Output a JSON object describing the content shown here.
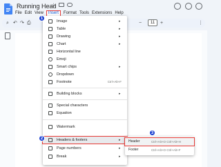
{
  "window": {
    "title": "Running Head"
  },
  "menubar": {
    "items": [
      "File",
      "Edit",
      "View",
      "Insert",
      "Format",
      "Tools",
      "Extensions",
      "Help"
    ]
  },
  "toolbar": {
    "font_size": "11",
    "icons": [
      "search-icon",
      "undo-icon",
      "redo-icon",
      "print-icon",
      "zoom-out-icon",
      "zoom-in-icon",
      "more-icon"
    ]
  },
  "insert_menu": {
    "items": [
      {
        "label": "Image",
        "submenu": true,
        "icon": "image-icon"
      },
      {
        "label": "Table",
        "submenu": true,
        "icon": "table-icon"
      },
      {
        "label": "Drawing",
        "submenu": true,
        "icon": "drawing-icon"
      },
      {
        "label": "Chart",
        "submenu": true,
        "icon": "chart-icon"
      },
      {
        "label": "Horizontal line",
        "icon": "horizontal-line-icon"
      },
      {
        "label": "Emoji",
        "icon": "emoji-icon"
      },
      {
        "label": "Smart chips",
        "submenu": true,
        "icon": "smart-chips-icon"
      },
      {
        "label": "Dropdown",
        "icon": "dropdown-icon"
      },
      {
        "label": "Footnote",
        "shortcut": "Ctrl+Alt+F",
        "icon": "footnote-icon"
      },
      {
        "label": "Building blocks",
        "submenu": true,
        "icon": "building-blocks-icon"
      },
      {
        "label": "Special characters",
        "icon": "special-characters-icon"
      },
      {
        "label": "Equation",
        "icon": "equation-icon"
      },
      {
        "label": "Watermark",
        "icon": "watermark-icon"
      },
      {
        "label": "Headers & footers",
        "submenu": true,
        "icon": "headers-footers-icon"
      },
      {
        "label": "Page numbers",
        "submenu": true,
        "icon": "page-numbers-icon"
      },
      {
        "label": "Break",
        "submenu": true,
        "icon": "break-icon"
      }
    ]
  },
  "headers_footers_submenu": {
    "items": [
      {
        "label": "Header",
        "shortcut": "Ctrl+Alt+O Ctrl+Alt+H"
      },
      {
        "label": "Footer",
        "shortcut": "Ctrl+Alt+O Ctrl+Alt+F"
      }
    ]
  },
  "step_badges": [
    "1",
    "2",
    "3"
  ],
  "colors": {
    "highlight_border": "#e53935",
    "badge": "#1a3fd1",
    "accent": "#0b57d0"
  }
}
